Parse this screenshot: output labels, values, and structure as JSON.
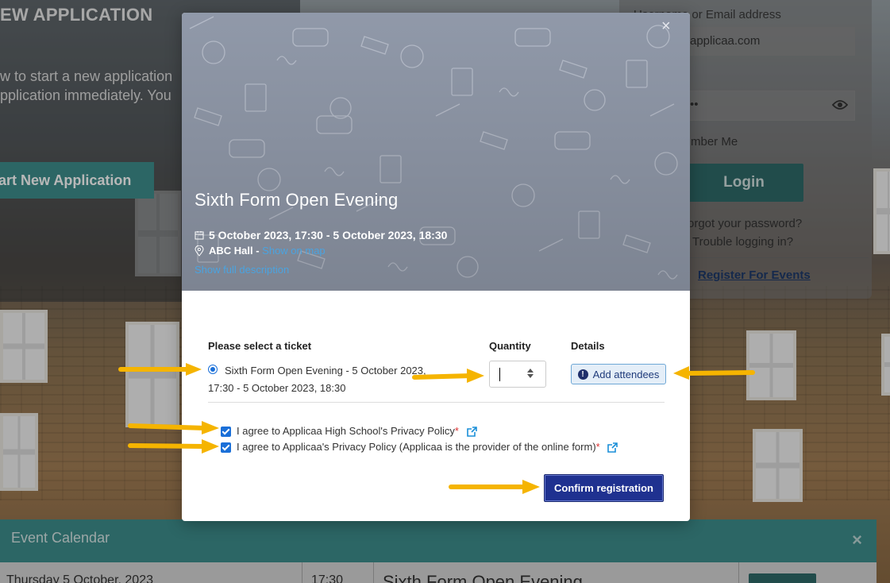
{
  "background": {
    "new_app_title": "EW APPLICATION",
    "new_app_text": "w to start a new application\npplication immediately. You",
    "start_button": "art New Application",
    "login": {
      "email_label": "Username or Email address",
      "email_value": "applicaa.com",
      "password_mask": "••",
      "remember_label": "mber Me",
      "login_button": "Login",
      "forgot_link": "orgot your password?",
      "trouble_link": "Trouble logging in?",
      "register_link": "Register For Events"
    },
    "calendar": {
      "title": "Event Calendar",
      "close": "×",
      "row_date": "Thursday 5 October, 2023",
      "row_time": "17:30",
      "row_event": "Sixth Form Open Evening"
    }
  },
  "modal": {
    "close": "×",
    "event_title": "Sixth Form Open Evening",
    "event_date": "5 October 2023, 17:30 - 5 October 2023, 18:30",
    "location_name": "ABC Hall - ",
    "map_link": "Show on map",
    "description_link": "Show full description",
    "headers": {
      "ticket": "Please select a ticket",
      "quantity": "Quantity",
      "details": "Details"
    },
    "ticket_label": "Sixth Form Open Evening - 5 October 2023, 17:30 - 5 October 2023, 18:30",
    "add_attendees": "Add attendees",
    "agree_school": "I agree to Applicaa High School's Privacy Policy",
    "agree_applicaa": "I agree to Applicaa's Privacy Policy (Applicaa is the provider of the online form)",
    "required_mark": "*",
    "confirm_button": "Confirm registration"
  },
  "colors": {
    "primary_blue": "#1f3190",
    "link_blue": "#4aa3e0",
    "teal": "#3e8e8c",
    "arrow_yellow": "#f5b400"
  }
}
